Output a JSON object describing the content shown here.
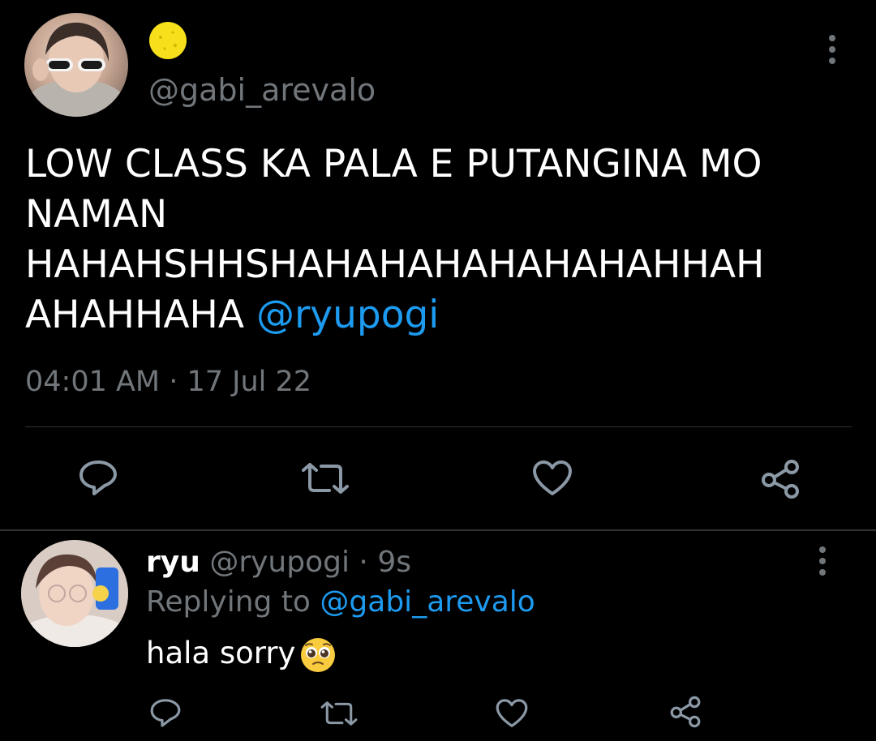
{
  "colors": {
    "background": "#000000",
    "text": "#ffffff",
    "secondary": "#71767b",
    "accent": "#1d9bf0",
    "divider": "#2f3336"
  },
  "main_tweet": {
    "author_display_name_icon": "yellow-circle-emoji",
    "handle": "@gabi_arevalo",
    "text_lines": [
      "LOW CLASS KA PALA E PUTANGINA MO",
      "NAMAN",
      "HAHAHSHHSHAHAHAHAHAHAHAHHAH",
      "AHAHHAHA"
    ],
    "mention": "@ryupogi",
    "timestamp": "04:01 AM · 17 Jul 22",
    "actions": [
      "reply-icon",
      "retweet-icon",
      "like-icon",
      "share-icon"
    ]
  },
  "reply": {
    "name": "ryu",
    "handle": "@ryupogi",
    "time": "9s",
    "replying_to_label": "Replying to",
    "replying_to_handle": "@gabi_arevalo",
    "text": "hala sorry",
    "emoji": "pleading-face-emoji",
    "actions": [
      "reply-icon",
      "retweet-icon",
      "like-icon",
      "share-icon"
    ]
  }
}
